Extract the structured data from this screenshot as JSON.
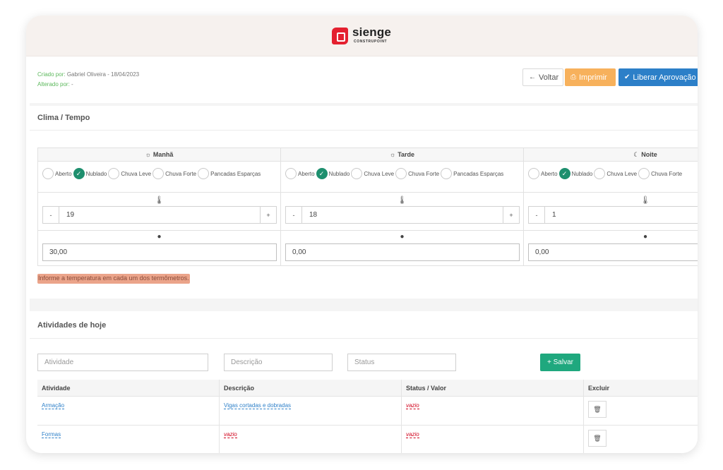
{
  "header": {
    "brand": "sienge",
    "brand_sub": "CONSTRUPOINT"
  },
  "meta": {
    "created_label": "Criado por:",
    "created_value": "Gabriel Oliveira - 18/04/2023",
    "altered_label": "Alterado por:",
    "altered_value": "-"
  },
  "toolbar": {
    "voltar": "Voltar",
    "imprimir": "Imprimir",
    "liberar": "Liberar Aprovação"
  },
  "clima": {
    "title": "Clima / Tempo",
    "periods": [
      {
        "name": "Manhã",
        "icon": "sun-icon",
        "options": [
          "Aberto",
          "Nublado",
          "Chuva Leve",
          "Chuva Forte",
          "Pancadas Esparças"
        ],
        "selected": "Nublado",
        "temperature": "19",
        "rain": "30,00"
      },
      {
        "name": "Tarde",
        "icon": "sun-icon",
        "options": [
          "Aberto",
          "Nublado",
          "Chuva Leve",
          "Chuva Forte",
          "Pancadas Esparças"
        ],
        "selected": "Nublado",
        "temperature": "18",
        "rain": "0,00"
      },
      {
        "name": "Noite",
        "icon": "moon-icon",
        "options": [
          "Aberto",
          "Nublado",
          "Chuva Leve",
          "Chuva Forte"
        ],
        "selected": "Nublado",
        "temperature": "1",
        "rain": "0,00"
      }
    ],
    "minus": "-",
    "plus": "+",
    "warning": "Informe a temperatura em cada um dos termômetros."
  },
  "atividades": {
    "title": "Atividades de hoje",
    "placeholders": {
      "atividade": "Atividade",
      "descricao": "Descrição",
      "status": "Status"
    },
    "save": "+ Salvar",
    "columns": [
      "Atividade",
      "Descrição",
      "Status / Valor",
      "Excluir"
    ],
    "rows": [
      {
        "atividade": "Armação",
        "descricao": "Vigas cortadas e dobradas",
        "status": "vazio"
      },
      {
        "atividade": "Formas",
        "descricao": "vazio",
        "status": "vazio"
      }
    ]
  }
}
